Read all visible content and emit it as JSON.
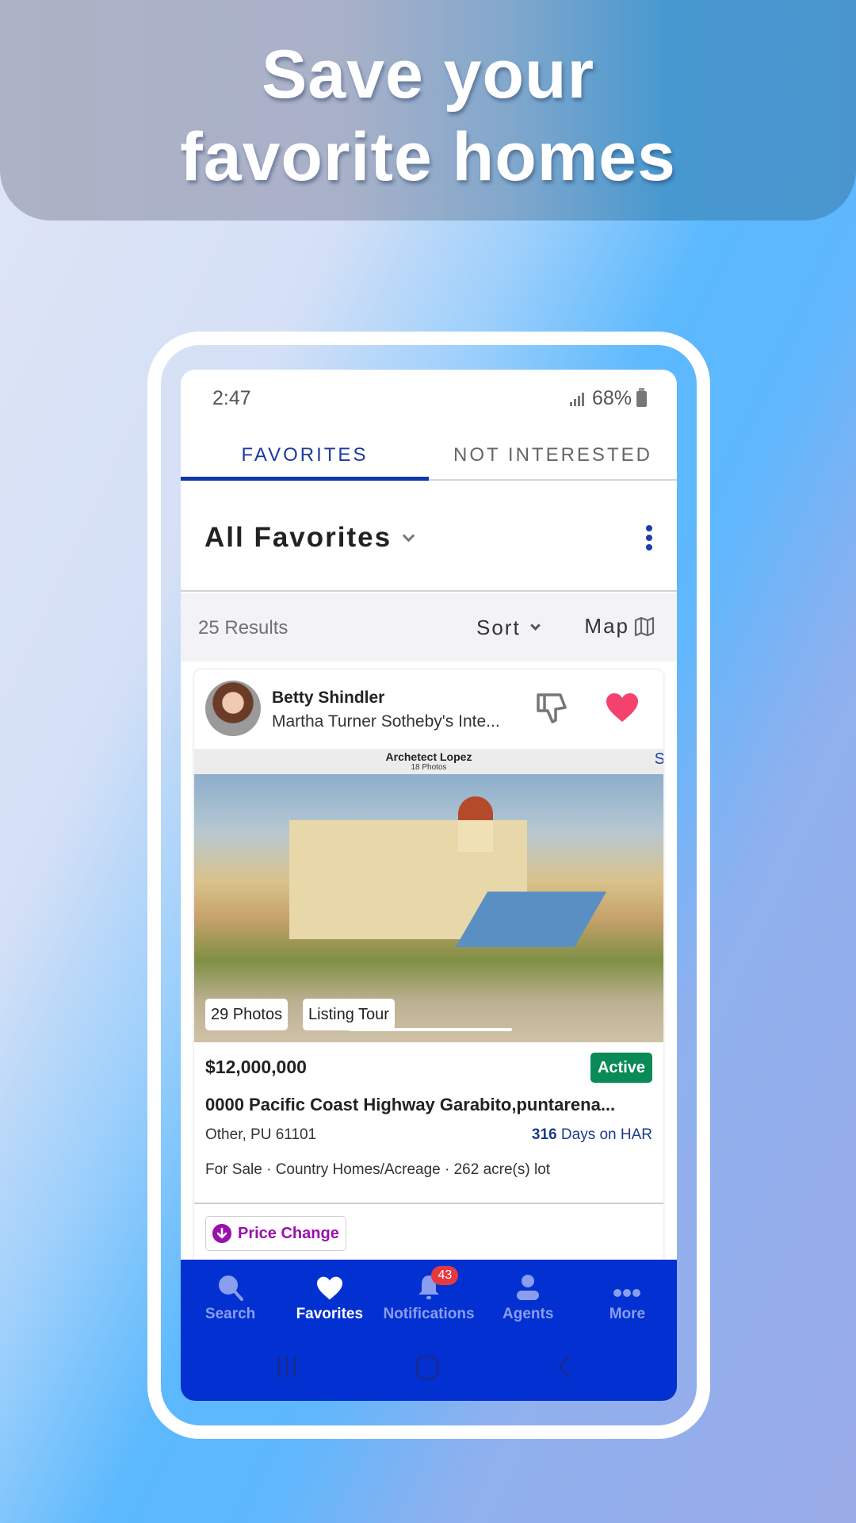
{
  "hero": {
    "line1": "Save your",
    "line2": "favorite homes"
  },
  "status_bar": {
    "time": "2:47",
    "battery": "68%"
  },
  "tabs": [
    {
      "label": "FAVORITES",
      "active": true
    },
    {
      "label": "NOT INTERESTED",
      "active": false
    }
  ],
  "list_header": {
    "title": "All Favorites"
  },
  "toolbar": {
    "results": "25 Results",
    "sort_label": "Sort",
    "map_label": "Map"
  },
  "listing": {
    "agent_name": "Betty Shindler",
    "brokerage": "Martha Turner Sotheby's Inte...",
    "photo_banner_title": "Archetect Lopez",
    "photo_banner_sub": "18 Photos",
    "photo_banner_next": "S",
    "photos_count": "29 Photos",
    "listing_tour": "Listing Tour",
    "price": "$12,000,000",
    "status": "Active",
    "status_color": "#0a8a56",
    "address": "0000 Pacific Coast Highway Garabito,puntarena...",
    "city": "Other, PU 61101",
    "days_count": "316",
    "days_suffix": " Days on HAR",
    "description": "For Sale · Country Homes/Acreage · 262 acre(s) lot",
    "price_change": "Price Change",
    "favorited": true
  },
  "bottom_nav": {
    "items": [
      {
        "label": "Search",
        "icon": "search-icon",
        "active": false
      },
      {
        "label": "Favorites",
        "icon": "heart-icon",
        "active": true
      },
      {
        "label": "Notifications",
        "icon": "bell-icon",
        "active": false,
        "badge": "43"
      },
      {
        "label": "Agents",
        "icon": "person-icon",
        "active": false
      },
      {
        "label": "More",
        "icon": "more-icon",
        "active": false
      }
    ]
  },
  "colors": {
    "accent": "#1237ad",
    "nav_bg": "#0230d1",
    "heart": "#f4426c",
    "price_change": "#9a10ae",
    "badge": "#e5393f"
  }
}
